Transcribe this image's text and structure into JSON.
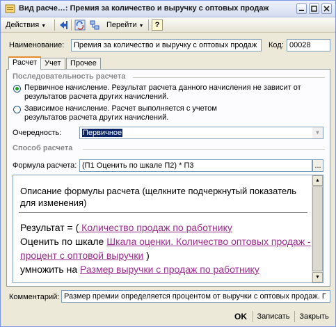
{
  "window": {
    "title": "Вид расче…: Премия за количество и выручку с оптовых продаж",
    "accent": "#e68b2c"
  },
  "toolbar": {
    "actions_label": "Действия",
    "goto_label": "Перейти",
    "help_label": "?"
  },
  "header": {
    "name_label": "Наименование:",
    "name_value": "Премия за количество и выручку с оптовых продаж",
    "code_label": "Код:",
    "code_value": "00028"
  },
  "tabs": [
    {
      "label": "Расчет",
      "active": true
    },
    {
      "label": "Учет",
      "active": false
    },
    {
      "label": "Прочее",
      "active": false
    }
  ],
  "sequence": {
    "title": "Последовательность расчета",
    "primary_text": "Первичное начисление. Результат расчета данного начисления не зависит от результатов расчета других начислений.",
    "dependent_text": "Зависимое начисление. Расчет выполняется с учетом результатов расчета других начислений.",
    "selected": "primary",
    "order_label": "Очередность:",
    "order_value": "Первичное"
  },
  "method": {
    "title": "Способ расчета",
    "formula_label": "Формула расчета:",
    "formula_value": "(П1 Оценить по шкале П2) * П3",
    "select_button": "...",
    "description_title": "Описание формулы расчета (щелкните подчеркнутый показатель для изменения)",
    "formula_text": {
      "prefix": "Результат = (",
      "p1": " Количество продаж по работнику",
      "mid1": "Оценить по шкале ",
      "p2": "Шкала оценки. Количество оптовых продаж - процент с оптовой выручки",
      "mid2": " )",
      "mid3": "умножить на ",
      "p3": "Размер выручки с продаж по работнику"
    }
  },
  "comment": {
    "label": "Комментарий:",
    "value": "Размер премии определяется процентом от выручки с оптовых продаж. Г"
  },
  "footer": {
    "ok_label": "OK",
    "save_label": "Записать",
    "close_label": "Закрыть"
  }
}
